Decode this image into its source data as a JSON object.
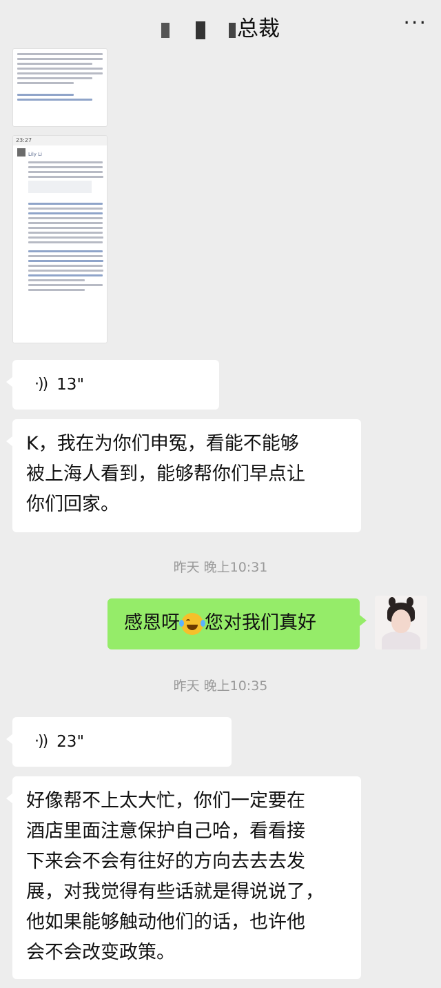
{
  "header": {
    "title": "总裁",
    "more_label": "···"
  },
  "messages": {
    "voice1": {
      "icon": "·))",
      "duration": "13\""
    },
    "text1": [
      "K，我在为你们申冤，看能不能够",
      "被上海人看到，能够帮你们早点让",
      "你们回家。"
    ],
    "time1": "昨天 晚上10:31",
    "mine1": {
      "before": "感恩呀",
      "after": "您对我们真好"
    },
    "time2": "昨天 晚上10:35",
    "voice2": {
      "icon": "·))",
      "duration": "23\""
    },
    "text2": [
      "好像帮不上太大忙，你们一定要在",
      "酒店里面注意保护自己哈，看看接",
      "下来会不会有往好的方向去去去发",
      "展，对我觉得有些话就是得说说了，",
      "他如果能够触动他们的话，也许他",
      "会不会改变政策。"
    ]
  },
  "shared_images": {
    "img2_top": "23:27",
    "img2_name": "Lily Li"
  }
}
